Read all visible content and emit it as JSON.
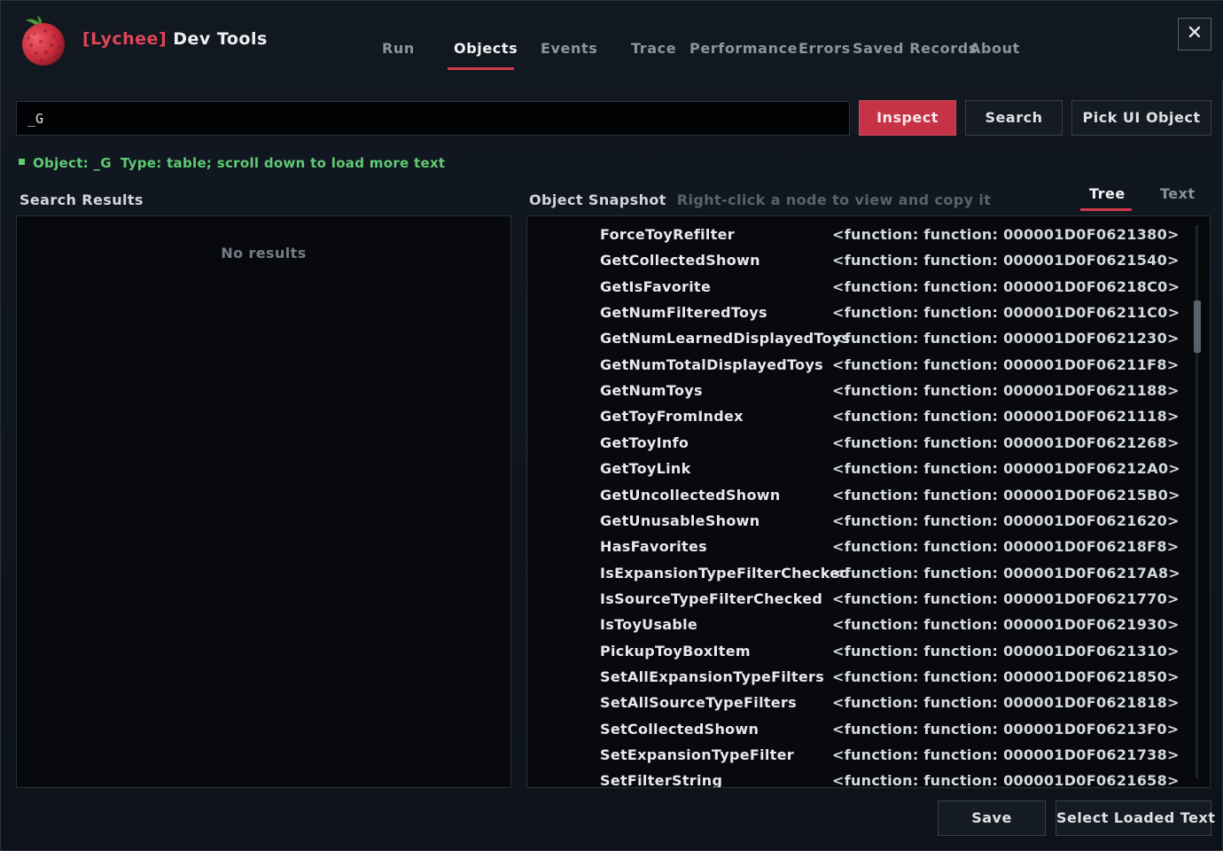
{
  "app": {
    "brand": "[Lychee]",
    "title": "Dev Tools"
  },
  "nav": {
    "tabs": [
      {
        "label": "Run"
      },
      {
        "label": "Objects"
      },
      {
        "label": "Events"
      },
      {
        "label": "Trace"
      },
      {
        "label": "Performance"
      },
      {
        "label": "Errors"
      },
      {
        "label": "Saved Records"
      },
      {
        "label": "About"
      }
    ],
    "active": "Objects"
  },
  "close_icon": "close-icon",
  "search": {
    "value": "_G"
  },
  "buttons": {
    "inspect": "Inspect",
    "search": "Search",
    "pick": "Pick UI Object",
    "save": "Save",
    "select_loaded": "Select Loaded Text"
  },
  "status": {
    "object": "Object: _G",
    "type": "Type: table; scroll down to load more text",
    "color": "#5fca72"
  },
  "search_results": {
    "title": "Search Results",
    "empty": "No results"
  },
  "snapshot": {
    "title": "Object Snapshot",
    "hint": "Right-click a node to view and copy it",
    "view_tabs": [
      {
        "label": "Tree"
      },
      {
        "label": "Text"
      }
    ],
    "rows": [
      {
        "key": "ForceToyRefilter",
        "value": "<function: function: 000001D0F0621380>"
      },
      {
        "key": "GetCollectedShown",
        "value": "<function: function: 000001D0F0621540>"
      },
      {
        "key": "GetIsFavorite",
        "value": "<function: function: 000001D0F06218C0>"
      },
      {
        "key": "GetNumFilteredToys",
        "value": "<function: function: 000001D0F06211C0>"
      },
      {
        "key": "GetNumLearnedDisplayedToys",
        "value": "<function: function: 000001D0F0621230>"
      },
      {
        "key": "GetNumTotalDisplayedToys",
        "value": "<function: function: 000001D0F06211F8>"
      },
      {
        "key": "GetNumToys",
        "value": "<function: function: 000001D0F0621188>"
      },
      {
        "key": "GetToyFromIndex",
        "value": "<function: function: 000001D0F0621118>"
      },
      {
        "key": "GetToyInfo",
        "value": "<function: function: 000001D0F0621268>"
      },
      {
        "key": "GetToyLink",
        "value": "<function: function: 000001D0F06212A0>"
      },
      {
        "key": "GetUncollectedShown",
        "value": "<function: function: 000001D0F06215B0>"
      },
      {
        "key": "GetUnusableShown",
        "value": "<function: function: 000001D0F0621620>"
      },
      {
        "key": "HasFavorites",
        "value": "<function: function: 000001D0F06218F8>"
      },
      {
        "key": "IsExpansionTypeFilterChecked",
        "value": "<function: function: 000001D0F06217A8>"
      },
      {
        "key": "IsSourceTypeFilterChecked",
        "value": "<function: function: 000001D0F0621770>"
      },
      {
        "key": "IsToyUsable",
        "value": "<function: function: 000001D0F0621930>"
      },
      {
        "key": "PickupToyBoxItem",
        "value": "<function: function: 000001D0F0621310>"
      },
      {
        "key": "SetAllExpansionTypeFilters",
        "value": "<function: function: 000001D0F0621850>"
      },
      {
        "key": "SetAllSourceTypeFilters",
        "value": "<function: function: 000001D0F0621818>"
      },
      {
        "key": "SetCollectedShown",
        "value": "<function: function: 000001D0F06213F0>"
      },
      {
        "key": "SetExpansionTypeFilter",
        "value": "<function: function: 000001D0F0621738>"
      },
      {
        "key": "SetFilterString",
        "value": "<function: function: 000001D0F0621658>"
      }
    ]
  },
  "colors": {
    "accent": "#d23a4c",
    "button_primary": "#c63346",
    "background": "#0f141b"
  }
}
